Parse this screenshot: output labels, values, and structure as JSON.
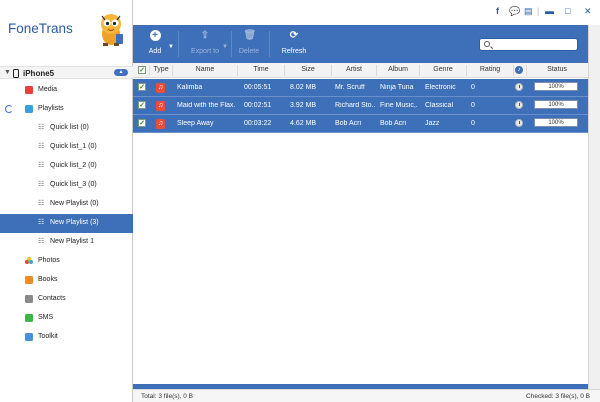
{
  "app": {
    "title": "FoneTrans"
  },
  "device": {
    "name": "iPhone5"
  },
  "sidebar": {
    "items": [
      {
        "label": "Media",
        "icon": "media-icon",
        "color": "#e8403a"
      },
      {
        "label": "Playlists",
        "icon": "playlist-icon",
        "color": "#3aa0d8"
      },
      {
        "label": "Quick list (0)"
      },
      {
        "label": "Quick list_1 (0)"
      },
      {
        "label": "Quick list_2 (0)"
      },
      {
        "label": "Quick list_3 (0)"
      },
      {
        "label": "New Playlist (0)"
      },
      {
        "label": "New Playlist (3)"
      },
      {
        "label": "New Playlist 1"
      },
      {
        "label": "Photos",
        "icon": "photos-icon"
      },
      {
        "label": "Books",
        "icon": "books-icon",
        "color": "#f08a24"
      },
      {
        "label": "Contacts",
        "icon": "contacts-icon",
        "color": "#8a8a8a"
      },
      {
        "label": "SMS",
        "icon": "sms-icon",
        "color": "#3cb54a"
      },
      {
        "label": "Toolkit",
        "icon": "toolkit-icon",
        "color": "#4a90d9"
      }
    ],
    "selected_index": 7
  },
  "toolbar": {
    "add": "Add",
    "export": "Export to",
    "delete": "Delete",
    "refresh": "Refresh"
  },
  "search": {
    "placeholder": ""
  },
  "table": {
    "columns": [
      "Type",
      "Name",
      "Time",
      "Size",
      "Artist",
      "Album",
      "Genre",
      "Rating",
      "Status"
    ],
    "rows": [
      {
        "name": "Kalimba",
        "time": "00:05:51",
        "size": "8.02 MB",
        "artist": "Mr. Scruff",
        "album": "Ninja Tuna",
        "genre": "Electronic",
        "rating": "0",
        "status": "100%",
        "progress": 1.0
      },
      {
        "name": "Maid with the Flax...",
        "time": "00:02:51",
        "size": "3.92 MB",
        "artist": "Richard Sto...",
        "album": "Fine Music,...",
        "genre": "Classical",
        "rating": "0",
        "status": "100%",
        "progress": 1.0
      },
      {
        "name": "Sleep Away",
        "time": "00:03:22",
        "size": "4.62 MB",
        "artist": "Bob Acri",
        "album": "Bob Acri",
        "genre": "Jazz",
        "rating": "0",
        "status": "100%",
        "progress": 1.0
      }
    ]
  },
  "status": {
    "total": "Total: 3 file(s), 0 B",
    "checked": "Checked: 3 file(s), 0 B"
  },
  "colors": {
    "accent": "#3e6fb9",
    "brand": "#2a5aa5"
  }
}
